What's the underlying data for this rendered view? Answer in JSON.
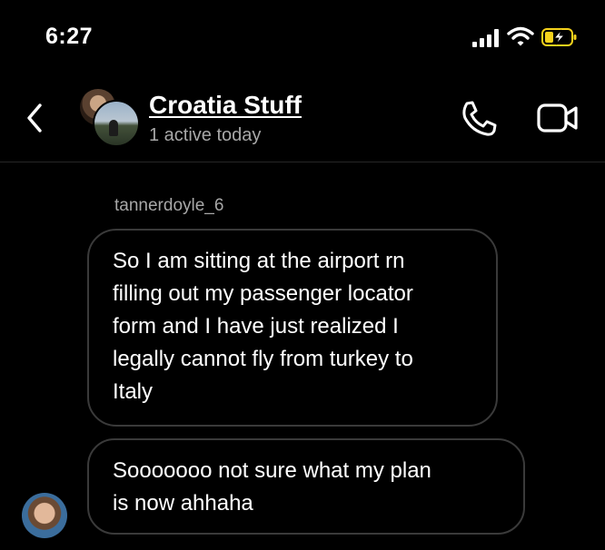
{
  "status_bar": {
    "time": "6:27"
  },
  "header": {
    "title": "Croatia Stuff",
    "subtitle": "1 active today",
    "back_icon": "chevron-left-icon",
    "call_icon": "phone-icon",
    "video_icon": "video-camera-icon"
  },
  "conversation": {
    "sender_name": "tannerdoyle_6",
    "messages": [
      {
        "lines": [
          "So I am sitting at the airport rn",
          "filling out my passenger locator",
          "form and I have just realized I",
          "legally cannot fly from turkey to",
          "Italy"
        ]
      },
      {
        "lines": [
          "Sooooooo not sure what my plan",
          "is now ahhaha"
        ]
      }
    ]
  },
  "colors": {
    "background": "#000000",
    "bubble_border": "#3a3a3a",
    "secondary_text": "#a8a8a8",
    "battery_charge": "#f5d21c"
  }
}
